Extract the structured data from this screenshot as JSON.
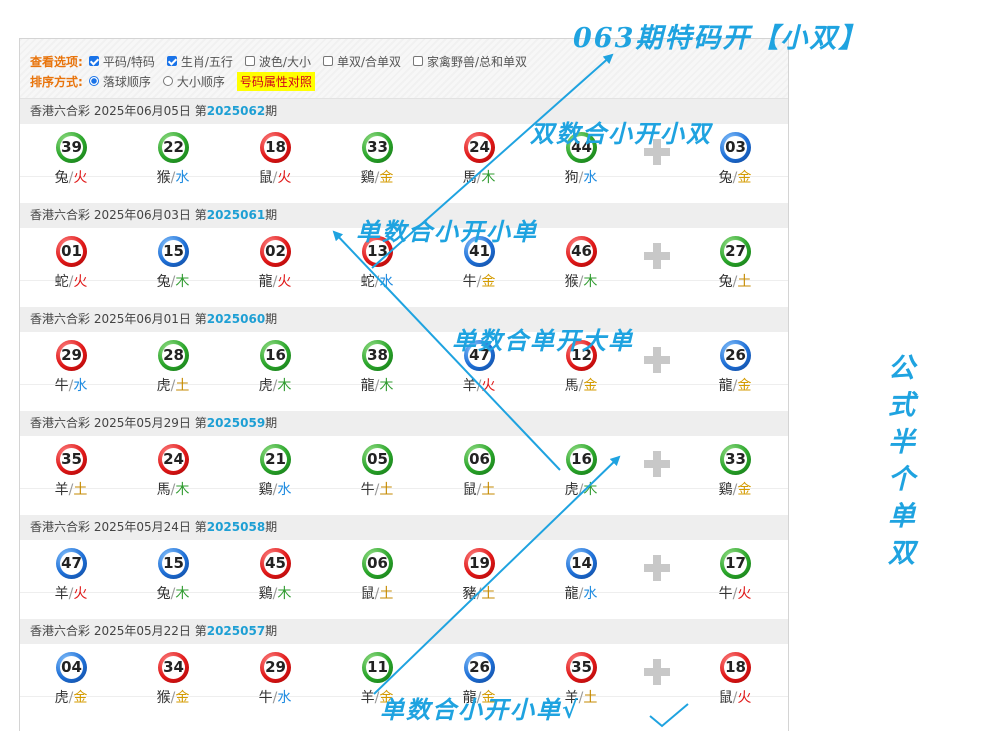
{
  "options": {
    "view_label": "查看选项:",
    "view_opts": [
      {
        "label": "平码/特码",
        "checked": true
      },
      {
        "label": "生肖/五行",
        "checked": true
      },
      {
        "label": "波色/大小",
        "checked": false
      },
      {
        "label": "单双/合单双",
        "checked": false
      },
      {
        "label": "家禽野兽/总和单双",
        "checked": false
      }
    ],
    "sort_label": "排序方式:",
    "sort_opts": [
      {
        "label": "落球顺序",
        "selected": true
      },
      {
        "label": "大小顺序",
        "selected": false
      }
    ],
    "attr_button": "号码属性对照"
  },
  "draws": [
    {
      "prefix": "香港六合彩 2025年06月05日 第",
      "issue": "2025062",
      "suffix": "期",
      "balls": [
        {
          "n": "39",
          "c": "green",
          "z": "兔",
          "e": "火",
          "ec": "fire"
        },
        {
          "n": "22",
          "c": "green",
          "z": "猴",
          "e": "水",
          "ec": "water"
        },
        {
          "n": "18",
          "c": "red",
          "z": "鼠",
          "e": "火",
          "ec": "fire"
        },
        {
          "n": "33",
          "c": "green",
          "z": "鷄",
          "e": "金",
          "ec": "metal"
        },
        {
          "n": "24",
          "c": "red",
          "z": "馬",
          "e": "木",
          "ec": "wood"
        },
        {
          "n": "44",
          "c": "green",
          "z": "狗",
          "e": "水",
          "ec": "water"
        },
        {
          "n": "03",
          "c": "blue",
          "z": "兔",
          "e": "金",
          "ec": "metal"
        }
      ]
    },
    {
      "prefix": "香港六合彩 2025年06月03日 第",
      "issue": "2025061",
      "suffix": "期",
      "balls": [
        {
          "n": "01",
          "c": "red",
          "z": "蛇",
          "e": "火",
          "ec": "fire"
        },
        {
          "n": "15",
          "c": "blue",
          "z": "兔",
          "e": "木",
          "ec": "wood"
        },
        {
          "n": "02",
          "c": "red",
          "z": "龍",
          "e": "火",
          "ec": "fire"
        },
        {
          "n": "13",
          "c": "red",
          "z": "蛇",
          "e": "水",
          "ec": "water"
        },
        {
          "n": "41",
          "c": "blue",
          "z": "牛",
          "e": "金",
          "ec": "metal"
        },
        {
          "n": "46",
          "c": "red",
          "z": "猴",
          "e": "木",
          "ec": "wood"
        },
        {
          "n": "27",
          "c": "green",
          "z": "兔",
          "e": "土",
          "ec": "earth"
        }
      ]
    },
    {
      "prefix": "香港六合彩 2025年06月01日 第",
      "issue": "2025060",
      "suffix": "期",
      "balls": [
        {
          "n": "29",
          "c": "red",
          "z": "牛",
          "e": "水",
          "ec": "water"
        },
        {
          "n": "28",
          "c": "green",
          "z": "虎",
          "e": "土",
          "ec": "earth"
        },
        {
          "n": "16",
          "c": "green",
          "z": "虎",
          "e": "木",
          "ec": "wood"
        },
        {
          "n": "38",
          "c": "green",
          "z": "龍",
          "e": "木",
          "ec": "wood"
        },
        {
          "n": "47",
          "c": "blue",
          "z": "羊",
          "e": "火",
          "ec": "fire"
        },
        {
          "n": "12",
          "c": "red",
          "z": "馬",
          "e": "金",
          "ec": "metal"
        },
        {
          "n": "26",
          "c": "blue",
          "z": "龍",
          "e": "金",
          "ec": "metal"
        }
      ]
    },
    {
      "prefix": "香港六合彩 2025年05月29日 第",
      "issue": "2025059",
      "suffix": "期",
      "balls": [
        {
          "n": "35",
          "c": "red",
          "z": "羊",
          "e": "土",
          "ec": "earth"
        },
        {
          "n": "24",
          "c": "red",
          "z": "馬",
          "e": "木",
          "ec": "wood"
        },
        {
          "n": "21",
          "c": "green",
          "z": "鷄",
          "e": "水",
          "ec": "water"
        },
        {
          "n": "05",
          "c": "green",
          "z": "牛",
          "e": "土",
          "ec": "earth"
        },
        {
          "n": "06",
          "c": "green",
          "z": "鼠",
          "e": "土",
          "ec": "earth"
        },
        {
          "n": "16",
          "c": "green",
          "z": "虎",
          "e": "木",
          "ec": "wood"
        },
        {
          "n": "33",
          "c": "green",
          "z": "鷄",
          "e": "金",
          "ec": "metal"
        }
      ]
    },
    {
      "prefix": "香港六合彩 2025年05月24日 第",
      "issue": "2025058",
      "suffix": "期",
      "balls": [
        {
          "n": "47",
          "c": "blue",
          "z": "羊",
          "e": "火",
          "ec": "fire"
        },
        {
          "n": "15",
          "c": "blue",
          "z": "兔",
          "e": "木",
          "ec": "wood"
        },
        {
          "n": "45",
          "c": "red",
          "z": "鷄",
          "e": "木",
          "ec": "wood"
        },
        {
          "n": "06",
          "c": "green",
          "z": "鼠",
          "e": "土",
          "ec": "earth"
        },
        {
          "n": "19",
          "c": "red",
          "z": "豬",
          "e": "土",
          "ec": "earth"
        },
        {
          "n": "14",
          "c": "blue",
          "z": "龍",
          "e": "水",
          "ec": "water"
        },
        {
          "n": "17",
          "c": "green",
          "z": "牛",
          "e": "火",
          "ec": "fire"
        }
      ]
    },
    {
      "prefix": "香港六合彩 2025年05月22日 第",
      "issue": "2025057",
      "suffix": "期",
      "balls": [
        {
          "n": "04",
          "c": "blue",
          "z": "虎",
          "e": "金",
          "ec": "metal"
        },
        {
          "n": "34",
          "c": "red",
          "z": "猴",
          "e": "金",
          "ec": "metal"
        },
        {
          "n": "29",
          "c": "red",
          "z": "牛",
          "e": "水",
          "ec": "water"
        },
        {
          "n": "11",
          "c": "green",
          "z": "羊",
          "e": "金",
          "ec": "metal"
        },
        {
          "n": "26",
          "c": "blue",
          "z": "龍",
          "e": "金",
          "ec": "metal"
        },
        {
          "n": "35",
          "c": "red",
          "z": "羊",
          "e": "土",
          "ec": "earth"
        },
        {
          "n": "18",
          "c": "red",
          "z": "鼠",
          "e": "火",
          "ec": "fire"
        }
      ]
    }
  ],
  "annotations": {
    "top": "063期特码开【小双】",
    "a1": "双数合小开小双",
    "a2": "单数合小开小单",
    "a3": "单数合单开大单",
    "a4": "单数合小开小单√",
    "side": "公式半个单双"
  },
  "colors": {
    "annotation": "#1fa3e0",
    "red": "#e01818",
    "blue": "#1e6fd6",
    "green": "#2aa52a",
    "issue": "#1e9fd4"
  }
}
